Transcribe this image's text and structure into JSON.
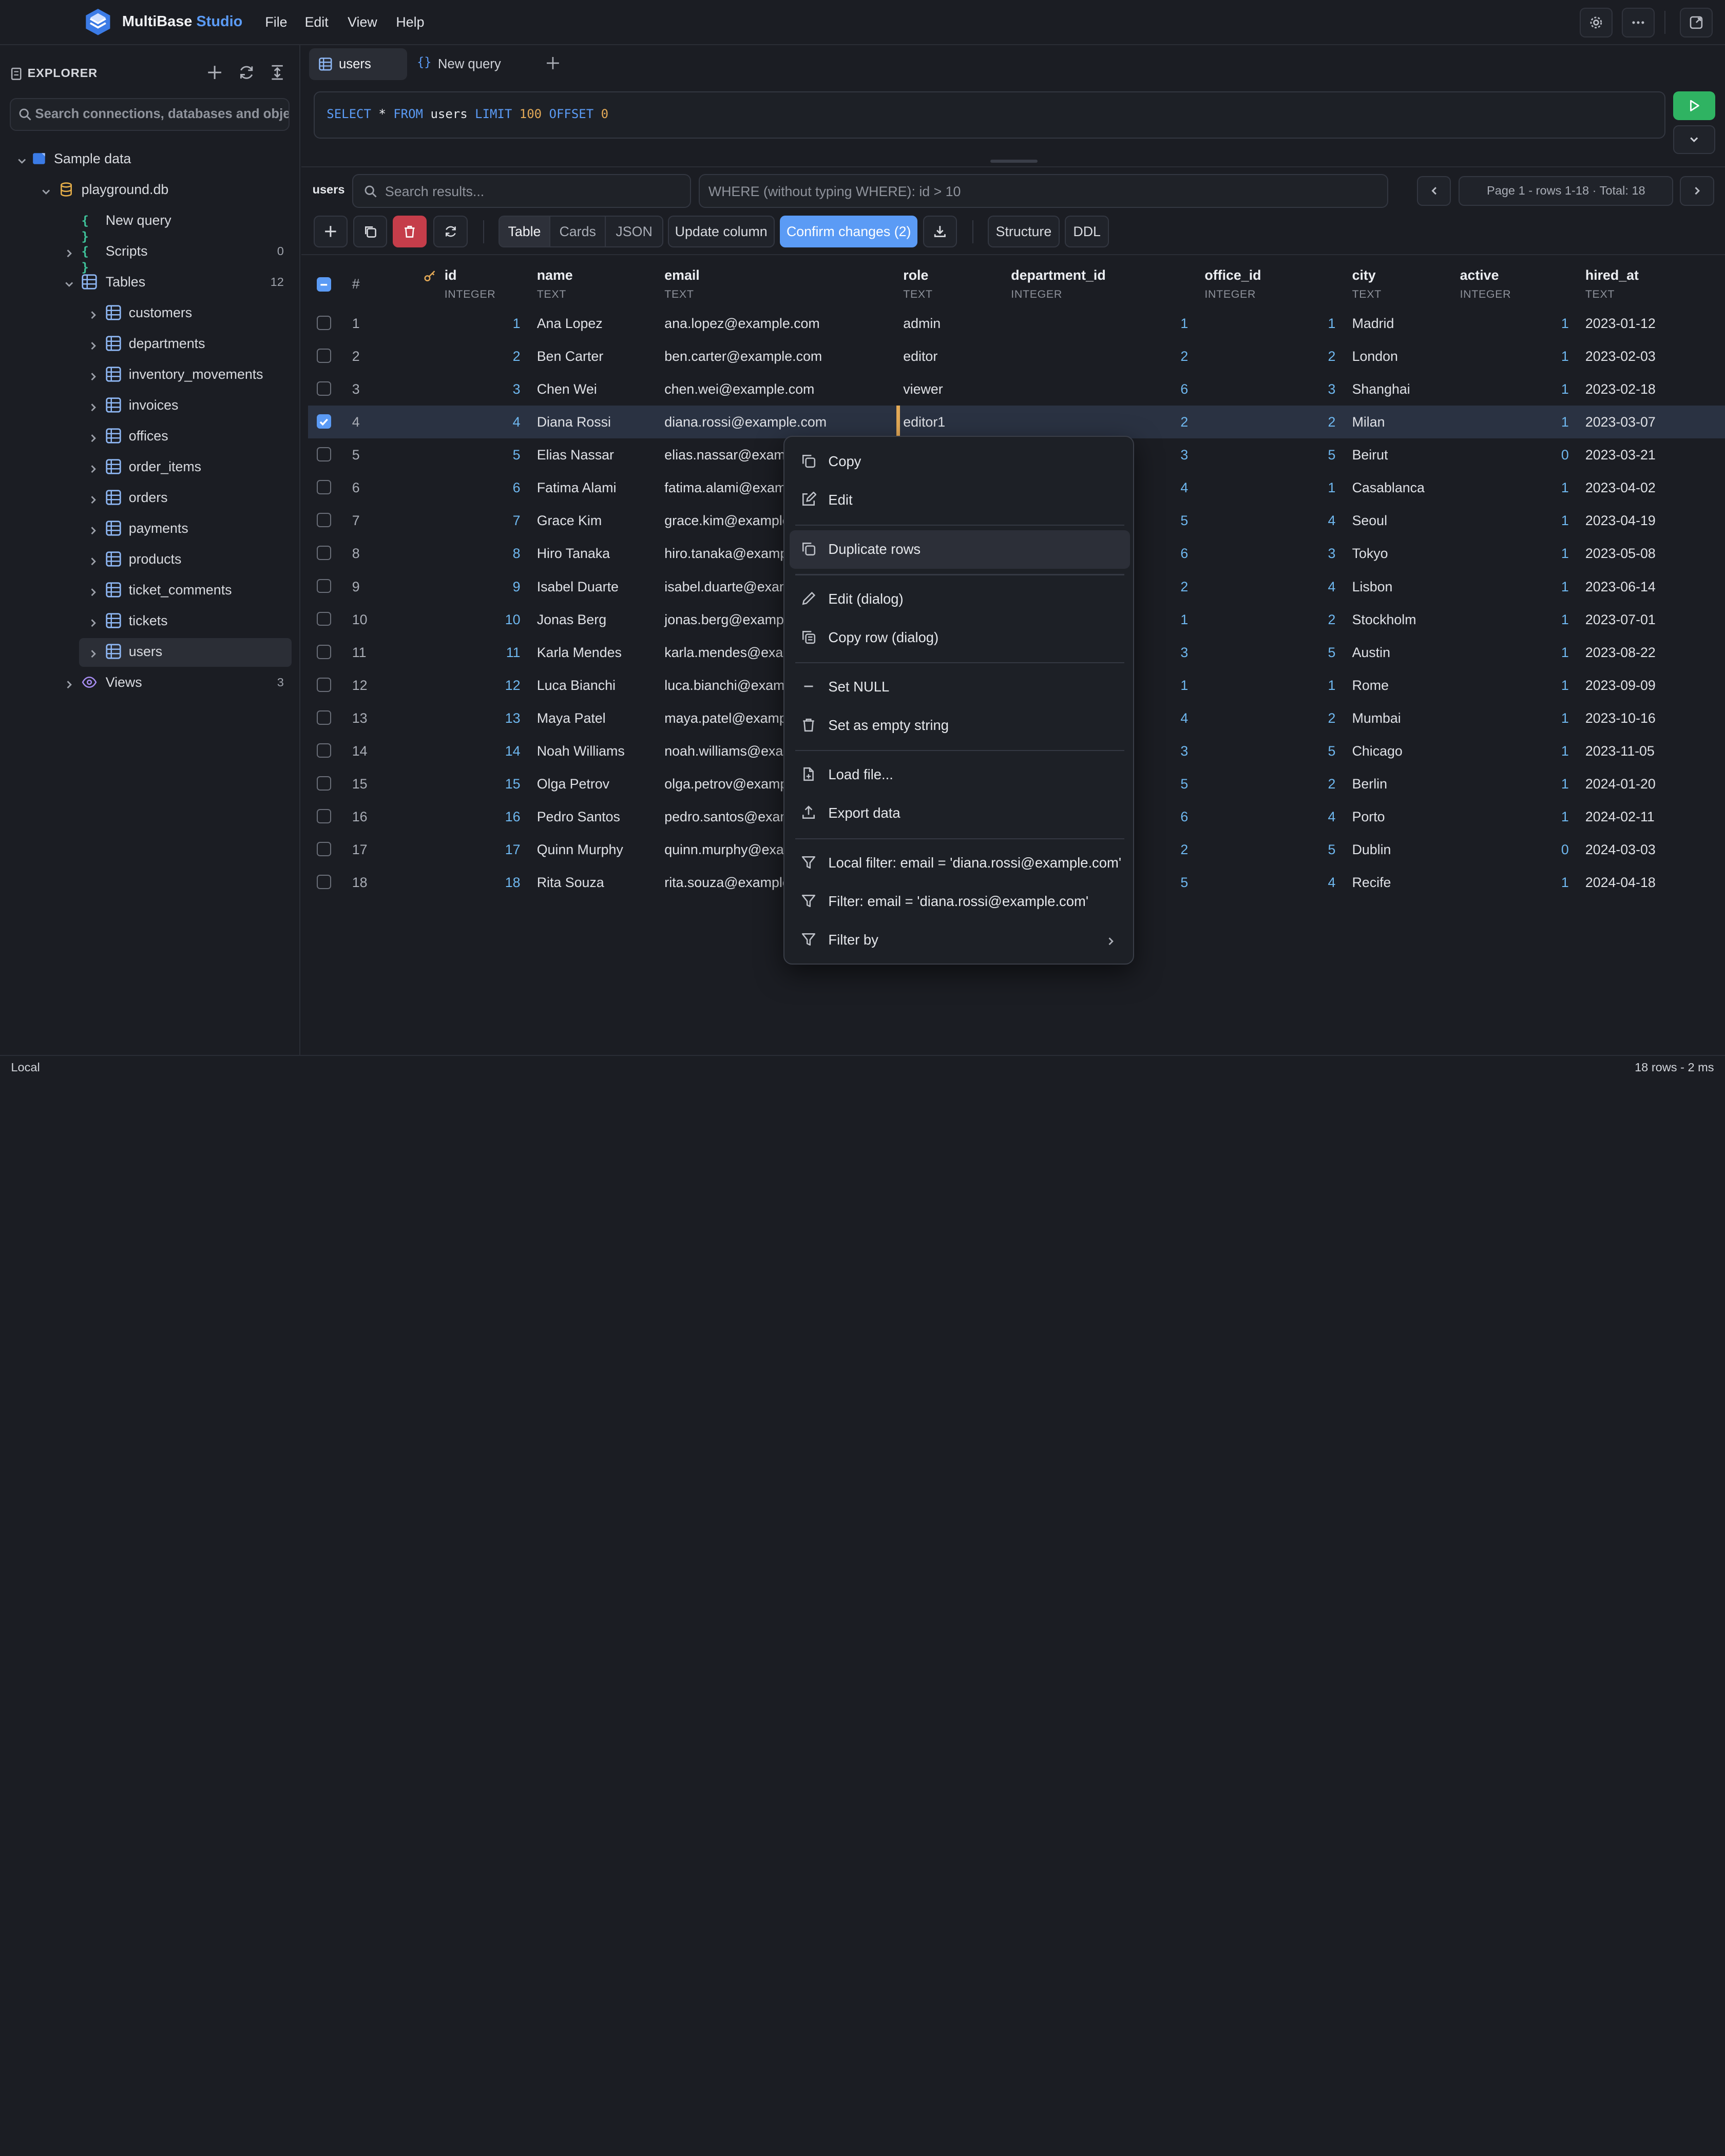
{
  "app": {
    "name_main": "MultiBase",
    "name_accent": "Studio",
    "accent_color": "#5b9bf5"
  },
  "menu": [
    "File",
    "Edit",
    "View",
    "Help"
  ],
  "top_icons": [
    "gear-icon",
    "more-icon",
    "window-icon"
  ],
  "sidebar": {
    "title": "EXPLORER",
    "search_placeholder": "Search connections, databases and objects",
    "tree": [
      {
        "label": "Sample data"
      },
      {
        "label": "playground.db"
      },
      {
        "label": "New query"
      },
      {
        "label": "Scripts",
        "count": "0"
      },
      {
        "label": "Tables",
        "count": "12"
      },
      {
        "label": "customers"
      },
      {
        "label": "departments"
      },
      {
        "label": "inventory_movements"
      },
      {
        "label": "invoices"
      },
      {
        "label": "offices"
      },
      {
        "label": "order_items"
      },
      {
        "label": "orders"
      },
      {
        "label": "payments"
      },
      {
        "label": "products"
      },
      {
        "label": "ticket_comments"
      },
      {
        "label": "tickets"
      },
      {
        "label": "users"
      },
      {
        "label": "Views",
        "count": "3"
      }
    ]
  },
  "tabs": [
    {
      "label": "users"
    },
    {
      "label": "New query"
    }
  ],
  "editor": {
    "sql": [
      "SELECT",
      " * ",
      "FROM",
      " users ",
      "LIMIT",
      " ",
      "100",
      " ",
      "OFFSET",
      " ",
      "0"
    ]
  },
  "results": {
    "table_label": "users",
    "search_placeholder": "Search results...",
    "where_placeholder": "WHERE (without typing WHERE): id > 10",
    "page_info": "Page 1 - rows 1-18 · Total: 18",
    "views": [
      "Table",
      "Cards",
      "JSON"
    ],
    "update_column": "Update column",
    "confirm_changes": "Confirm changes (2)",
    "structure": "Structure",
    "ddl": "DDL"
  },
  "grid": {
    "columns": [
      {
        "name": "#",
        "type": ""
      },
      {
        "name": "id",
        "type": "INTEGER"
      },
      {
        "name": "name",
        "type": "TEXT"
      },
      {
        "name": "email",
        "type": "TEXT"
      },
      {
        "name": "role",
        "type": "TEXT"
      },
      {
        "name": "department_id",
        "type": "INTEGER"
      },
      {
        "name": "office_id",
        "type": "INTEGER"
      },
      {
        "name": "city",
        "type": "TEXT"
      },
      {
        "name": "active",
        "type": "INTEGER"
      },
      {
        "name": "hired_at",
        "type": "TEXT"
      }
    ],
    "rows": [
      [
        "1",
        "1",
        "Ana Lopez",
        "ana.lopez@example.com",
        "admin",
        "1",
        "1",
        "Madrid",
        "1",
        "2023-01-12"
      ],
      [
        "2",
        "2",
        "Ben Carter",
        "ben.carter@example.com",
        "editor",
        "2",
        "2",
        "London",
        "1",
        "2023-02-03"
      ],
      [
        "3",
        "3",
        "Chen Wei",
        "chen.wei@example.com",
        "viewer",
        "6",
        "3",
        "Shanghai",
        "1",
        "2023-02-18"
      ],
      [
        "4",
        "4",
        "Diana Rossi",
        "diana.rossi@example.com",
        "editor1",
        "2",
        "2",
        "Milan",
        "1",
        "2023-03-07"
      ],
      [
        "5",
        "5",
        "Elias Nassar",
        "elias.nassar@examp",
        "",
        "3",
        "5",
        "Beirut",
        "0",
        "2023-03-21"
      ],
      [
        "6",
        "6",
        "Fatima Alami",
        "fatima.alami@examp",
        "",
        "4",
        "1",
        "Casablanca",
        "1",
        "2023-04-02"
      ],
      [
        "7",
        "7",
        "Grace Kim",
        "grace.kim@example",
        "",
        "5",
        "4",
        "Seoul",
        "1",
        "2023-04-19"
      ],
      [
        "8",
        "8",
        "Hiro Tanaka",
        "hiro.tanaka@examp",
        "",
        "6",
        "3",
        "Tokyo",
        "1",
        "2023-05-08"
      ],
      [
        "9",
        "9",
        "Isabel Duarte",
        "isabel.duarte@exam",
        "",
        "2",
        "4",
        "Lisbon",
        "1",
        "2023-06-14"
      ],
      [
        "10",
        "10",
        "Jonas Berg",
        "jonas.berg@exampl",
        "",
        "1",
        "2",
        "Stockholm",
        "1",
        "2023-07-01"
      ],
      [
        "11",
        "11",
        "Karla Mendes",
        "karla.mendes@exam",
        "",
        "3",
        "5",
        "Austin",
        "1",
        "2023-08-22"
      ],
      [
        "12",
        "12",
        "Luca Bianchi",
        "luca.bianchi@examp",
        "",
        "1",
        "1",
        "Rome",
        "1",
        "2023-09-09"
      ],
      [
        "13",
        "13",
        "Maya Patel",
        "maya.patel@exampl",
        "",
        "4",
        "2",
        "Mumbai",
        "1",
        "2023-10-16"
      ],
      [
        "14",
        "14",
        "Noah Williams",
        "noah.williams@exan",
        "",
        "3",
        "5",
        "Chicago",
        "1",
        "2023-11-05"
      ],
      [
        "15",
        "15",
        "Olga Petrov",
        "olga.petrov@examp",
        "",
        "5",
        "2",
        "Berlin",
        "1",
        "2024-01-20"
      ],
      [
        "16",
        "16",
        "Pedro Santos",
        "pedro.santos@exam",
        "",
        "6",
        "4",
        "Porto",
        "1",
        "2024-02-11"
      ],
      [
        "17",
        "17",
        "Quinn Murphy",
        "quinn.murphy@exar",
        "",
        "2",
        "5",
        "Dublin",
        "0",
        "2024-03-03"
      ],
      [
        "18",
        "18",
        "Rita Souza",
        "rita.souza@example",
        "",
        "5",
        "4",
        "Recife",
        "1",
        "2024-04-18"
      ]
    ]
  },
  "context_menu": [
    {
      "label": "Copy",
      "icon": "copy-icon"
    },
    {
      "label": "Edit",
      "icon": "edit-icon"
    },
    {
      "label": "Duplicate rows",
      "icon": "duplicate-icon"
    },
    {
      "label": "Edit (dialog)",
      "icon": "pencil-icon"
    },
    {
      "label": "Copy row (dialog)",
      "icon": "copy-row-icon"
    },
    {
      "label": "Set NULL",
      "icon": "minus-icon"
    },
    {
      "label": "Set as empty string",
      "icon": "trash-icon"
    },
    {
      "label": "Load file...",
      "icon": "file-icon"
    },
    {
      "label": "Export data",
      "icon": "upload-icon"
    },
    {
      "label": "Local filter: email = 'diana.rossi@example.com'",
      "icon": "filter-icon"
    },
    {
      "label": "Filter: email = 'diana.rossi@example.com'",
      "icon": "filter-icon"
    },
    {
      "label": "Filter by",
      "icon": "filter-icon"
    }
  ],
  "status": {
    "left": "Local",
    "right": "18 rows - 2 ms"
  }
}
